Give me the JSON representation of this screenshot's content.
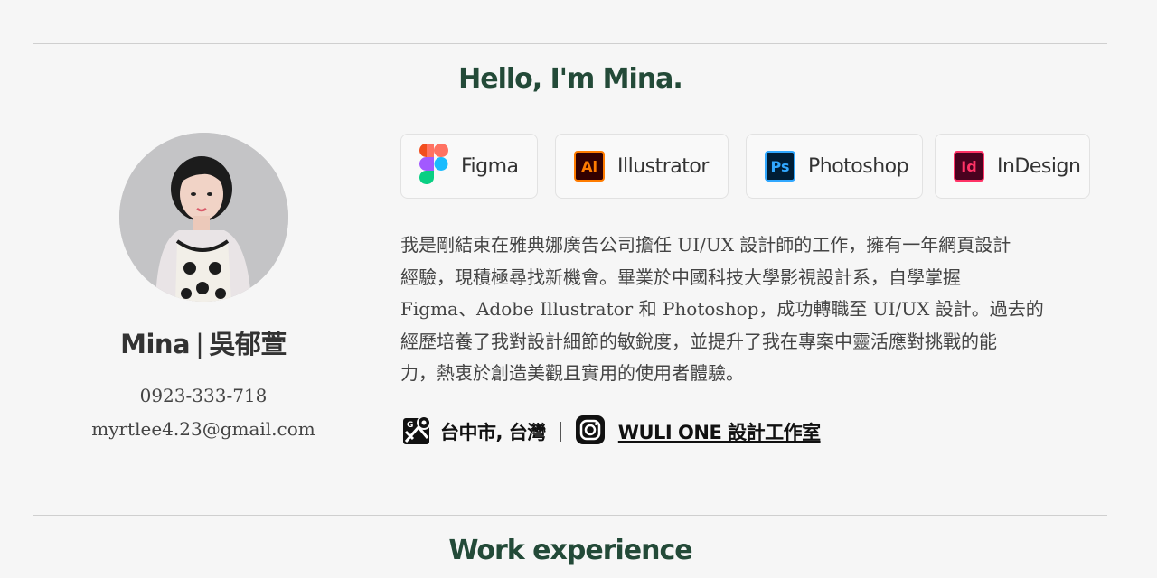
{
  "hero": {
    "title": "Hello, I'm Mina."
  },
  "profile": {
    "name_en": "Mina",
    "separator": "|",
    "name_zh": "吳郁萱",
    "phone": "0923-333-718",
    "email": "myrtlee4.23@gmail.com"
  },
  "tools": [
    {
      "label": "Figma",
      "icon": "figma-icon"
    },
    {
      "label": "Illustrator",
      "icon": "illustrator-icon",
      "abbr": "Ai",
      "color": "#ff7c00",
      "bg": "#330000"
    },
    {
      "label": "Photoshop",
      "icon": "photoshop-icon",
      "abbr": "Ps",
      "color": "#31a8ff",
      "bg": "#001e36"
    },
    {
      "label": "InDesign",
      "icon": "indesign-icon",
      "abbr": "Id",
      "color": "#ff3366",
      "bg": "#49021f"
    }
  ],
  "bio": {
    "line1": "我是剛結束在雅典娜廣告公司擔任 UI/UX 設計師的工作，擁有一年網頁設計",
    "line2": "經驗，現積極尋找新機會。畢業於中國科技大學影視設計系，自學掌握",
    "line3": "Figma、Adobe Illustrator 和 Photoshop，成功轉職至 UI/UX 設計。過去的",
    "line4": "經歷培養了我對設計細節的敏銳度，並提升了我在專案中靈活應對挑戰的能",
    "line5": "力，熱衷於創造美觀且實用的使用者體驗。"
  },
  "contact": {
    "location": "台中市, 台灣",
    "location_icon": "map-icon",
    "studio_icon": "instagram-icon",
    "studio_label": "WULI ONE 設計工作室"
  },
  "colors": {
    "heading": "#234a38",
    "background": "#f6f6f6"
  },
  "section_next": {
    "title": "Work experience"
  }
}
